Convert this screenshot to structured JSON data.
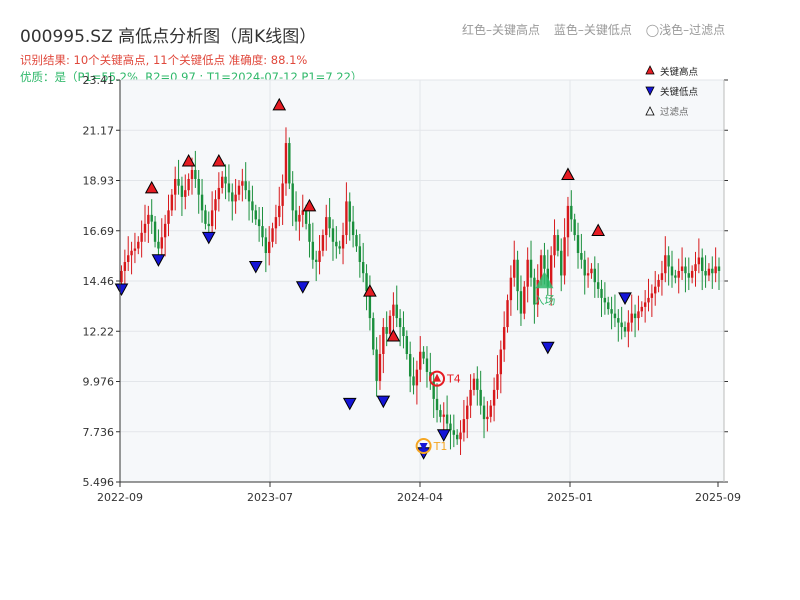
{
  "header": {
    "title": "000995.SZ 高低点分析图（周K线图）",
    "result_line": "识别结果: 10个关键高点, 11个关键低点  准确度: 88.1%",
    "quality_line": "优质：是（P1=55.2%, R2=0.97 ; T1=2024-07-12 P1=7.22）",
    "legend_red": "红色–关键高点",
    "legend_blue": "蓝色–关键低点",
    "legend_light": "◯浅色–过滤点"
  },
  "colors": {
    "up": "#d7191c",
    "down": "#1a8f3c",
    "high_marker": "#e51c23",
    "low_marker": "#1515d6",
    "annotation": "#f5a623",
    "entry": "#2fb86a",
    "grid": "#e3e6ea",
    "plot_bg": "#f6f8fa"
  },
  "chart_data": {
    "type": "candlestick",
    "ylim": [
      5.496,
      23.41
    ],
    "yticks": [
      "5.496",
      "7.736",
      "9.976",
      "12.22",
      "14.46",
      "16.69",
      "18.93",
      "21.17",
      "23.41"
    ],
    "xtick_labels": [
      "2022-09",
      "2023-07",
      "2024-04",
      "2025-01"
    ],
    "xtick_label_end": "2025-09",
    "legend": {
      "high": "关键高点",
      "low": "关键低点",
      "filtered": "过滤点"
    },
    "closes": [
      14.9,
      15.3,
      15.6,
      15.8,
      15.9,
      16.2,
      16.6,
      17.0,
      17.4,
      17.1,
      16.2,
      15.9,
      16.4,
      17.0,
      17.6,
      18.3,
      19.0,
      18.7,
      18.2,
      18.5,
      19.0,
      19.4,
      19.0,
      18.3,
      17.6,
      17.0,
      16.9,
      17.6,
      18.1,
      18.6,
      19.1,
      18.8,
      18.4,
      18.0,
      18.3,
      18.7,
      18.9,
      18.5,
      18.0,
      17.6,
      17.2,
      16.9,
      16.4,
      15.7,
      16.2,
      16.8,
      17.3,
      17.8,
      18.8,
      20.6,
      18.8,
      17.6,
      17.1,
      17.4,
      17.6,
      17.0,
      16.2,
      15.4,
      15.3,
      15.8,
      16.5,
      17.3,
      16.8,
      16.2,
      16.0,
      15.9,
      16.5,
      18.0,
      17.1,
      16.5,
      16.0,
      15.3,
      14.8,
      14.0,
      12.8,
      11.4,
      10.0,
      11.2,
      12.4,
      12.1,
      12.9,
      13.4,
      12.8,
      12.4,
      12.0,
      11.2,
      10.2,
      9.8,
      10.5,
      11.3,
      11.0,
      10.4,
      10.0,
      9.2,
      8.7,
      8.4,
      8.5,
      8.1,
      7.8,
      7.6,
      7.4,
      7.7,
      8.3,
      8.9,
      9.6,
      10.1,
      9.6,
      8.9,
      8.3,
      8.4,
      8.9,
      9.6,
      10.3,
      11.4,
      12.4,
      13.6,
      14.6,
      15.4,
      14.0,
      13.0,
      14.2,
      15.4,
      14.6,
      13.4,
      14.5,
      15.6,
      15.0,
      14.2,
      15.6,
      16.5,
      15.8,
      14.7,
      16.4,
      17.8,
      17.2,
      16.5,
      15.7,
      15.4,
      14.7,
      14.8,
      15.0,
      14.4,
      14.1,
      13.7,
      13.5,
      13.2,
      13.0,
      12.8,
      12.6,
      12.4,
      12.2,
      12.6,
      13.0,
      12.8,
      13.1,
      13.3,
      13.5,
      13.7,
      13.9,
      14.2,
      14.5,
      14.8,
      15.6,
      15.1,
      14.7,
      14.6,
      14.9,
      15.1,
      14.8,
      14.6,
      14.9,
      15.2,
      15.5,
      14.9,
      14.7,
      15.0,
      14.8,
      15.1,
      14.9
    ],
    "key_highs": [
      [
        9,
        18.2
      ],
      [
        20,
        19.4
      ],
      [
        29,
        19.4
      ],
      [
        47,
        21.9
      ],
      [
        56,
        17.4
      ],
      [
        74,
        13.6
      ],
      [
        81,
        11.6
      ],
      [
        133,
        18.8
      ],
      [
        142,
        16.3
      ]
    ],
    "key_lows": [
      [
        0,
        14.5
      ],
      [
        11,
        15.8
      ],
      [
        26,
        16.8
      ],
      [
        40,
        15.5
      ],
      [
        54,
        14.6
      ],
      [
        68,
        9.4
      ],
      [
        78,
        9.5
      ],
      [
        90,
        7.2
      ],
      [
        96,
        8.0
      ],
      [
        127,
        11.9
      ],
      [
        150,
        14.1
      ]
    ],
    "annotations": [
      {
        "label": "T1",
        "type": "low",
        "index": 90,
        "value": 7.1
      },
      {
        "label": "T4",
        "type": "high",
        "index": 94,
        "value": 10.1
      }
    ],
    "entry": {
      "label": "入场",
      "index": 126,
      "value": 14.4
    }
  }
}
